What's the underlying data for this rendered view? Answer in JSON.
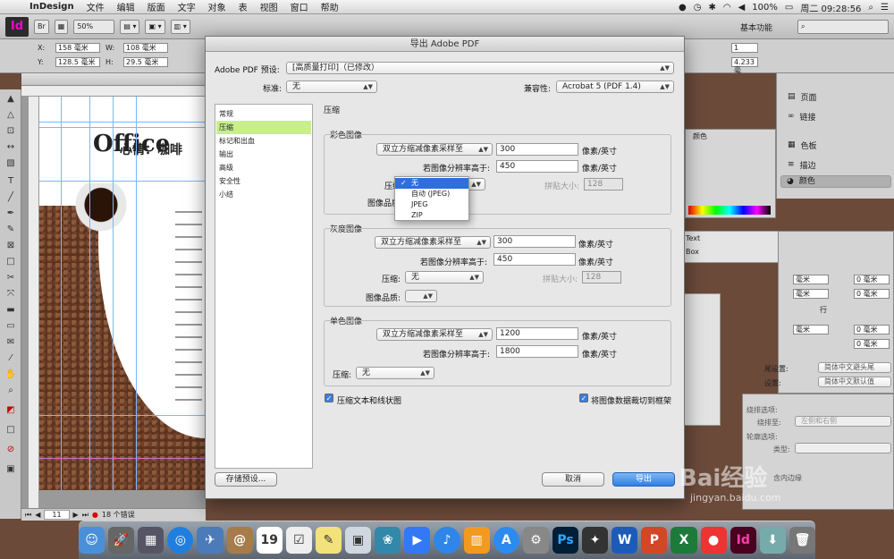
{
  "menubar": {
    "app": "InDesign",
    "items": [
      "文件",
      "编辑",
      "版面",
      "文字",
      "对象",
      "表",
      "视图",
      "窗口",
      "帮助"
    ],
    "battery": "100%",
    "clock": "周二 09:28:56"
  },
  "appbar": {
    "zoom": "50%",
    "workspace": "基本功能",
    "br": "Br"
  },
  "control": {
    "x": "158 毫米",
    "y": "128.5 毫米",
    "w": "108 毫米",
    "h": "29.5 毫米",
    "x_label": "X:",
    "y_label": "Y:",
    "w_label": "W:",
    "h_label": "H:",
    "stroke": "4.233 毫",
    "pt": "1"
  },
  "document": {
    "title_big": "Office",
    "title_sub": "心情：咖啡",
    "page_num": "11",
    "errors": "18 个错误"
  },
  "right_panel": {
    "items": [
      "页面",
      "链接",
      "色板",
      "描边",
      "颜色"
    ],
    "color_tab": "颜色",
    "text_label": "Text",
    "box_label": "Box",
    "para": {
      "row": "行",
      "mm0": "0 毫米",
      "mm": "毫米"
    },
    "set1_label": "尾设置:",
    "set1_value": "简体中文避头尾",
    "set2_label": "设置:",
    "set2_value": "简体中文默认值",
    "wrap_label": "绕排选项:",
    "wrap_to": "绕排至:",
    "wrap_to_value": "左侧和右侧",
    "contour_label": "轮廓选项:",
    "type_label": "类型:",
    "inner_edge": "含内边缘"
  },
  "dialog": {
    "title": "导出 Adobe PDF",
    "preset_label": "Adobe PDF 预设:",
    "preset_value": "[高质量打印]（已修改）",
    "standard_label": "标准:",
    "standard_value": "无",
    "compat_label": "兼容性:",
    "compat_value": "Acrobat 5 (PDF 1.4)",
    "nav": [
      "常规",
      "压缩",
      "标记和出血",
      "输出",
      "高级",
      "安全性",
      "小结"
    ],
    "section_title": "压缩",
    "color": {
      "title": "彩色图像",
      "downsample": "双立方缩减像素采样至",
      "ppi": "300",
      "unit": "像素/英寸",
      "above_label": "若图像分辨率高于:",
      "above": "450",
      "compress_label": "压缩:",
      "tile_label": "拼贴大小:",
      "tile": "128",
      "quality_label": "图像品质:"
    },
    "gray": {
      "title": "灰度图像",
      "downsample": "双立方缩减像素采样至",
      "ppi": "300",
      "unit": "像素/英寸",
      "above_label": "若图像分辨率高于:",
      "above": "450",
      "compress_label": "压缩:",
      "compress": "无",
      "tile_label": "拼贴大小:",
      "tile": "128",
      "quality_label": "图像品质:"
    },
    "mono": {
      "title": "单色图像",
      "downsample": "双立方缩减像素采样至",
      "ppi": "1200",
      "unit": "像素/英寸",
      "above_label": "若图像分辨率高于:",
      "above": "1800",
      "compress_label": "压缩:",
      "compress": "无"
    },
    "chk_text": "压缩文本和线状图",
    "chk_crop": "将图像数据裁切到框架",
    "save_preset": "存储预设...",
    "cancel": "取消",
    "export": "导出",
    "dropdown": {
      "items": [
        "无",
        "自动 (JPEG)",
        "JPEG",
        "ZIP"
      ],
      "selected": "无"
    }
  },
  "dock": {
    "calendar_day": "19",
    "apps": [
      "Ps",
      "W",
      "P",
      "X",
      "Id"
    ]
  },
  "watermark": {
    "logo": "Bai经验",
    "url": "jingyan.baidu.com"
  }
}
